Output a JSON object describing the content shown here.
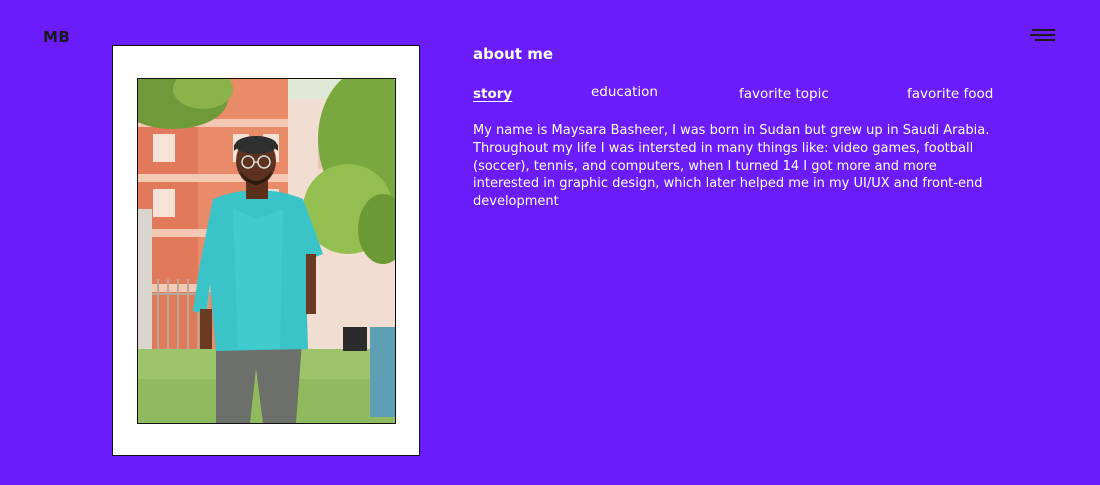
{
  "header": {
    "logo_text": "MB",
    "menu_icon": "hamburger-menu-icon"
  },
  "photo": {
    "alt": "portrait of Maysara Basheer"
  },
  "about": {
    "title": "about me",
    "tabs": [
      {
        "label": "story",
        "active": true
      },
      {
        "label": "education",
        "active": false
      },
      {
        "label": "favorite topic",
        "active": false
      },
      {
        "label": "favorite food",
        "active": false
      }
    ],
    "story_text": "My name is Maysara Basheer, I was born in Sudan but grew up in Saudi Arabia. Throughout my life I was intersted in many things like: video games, football (soccer), tennis, and computers, when I turned 14 I got more and more interested in graphic design, which later helped me in my UI/UX and front-end development"
  },
  "colors": {
    "background": "#6a1cfb",
    "text": "#ffffff",
    "logo": "#1a1a1a",
    "frame": "#ffffff"
  }
}
